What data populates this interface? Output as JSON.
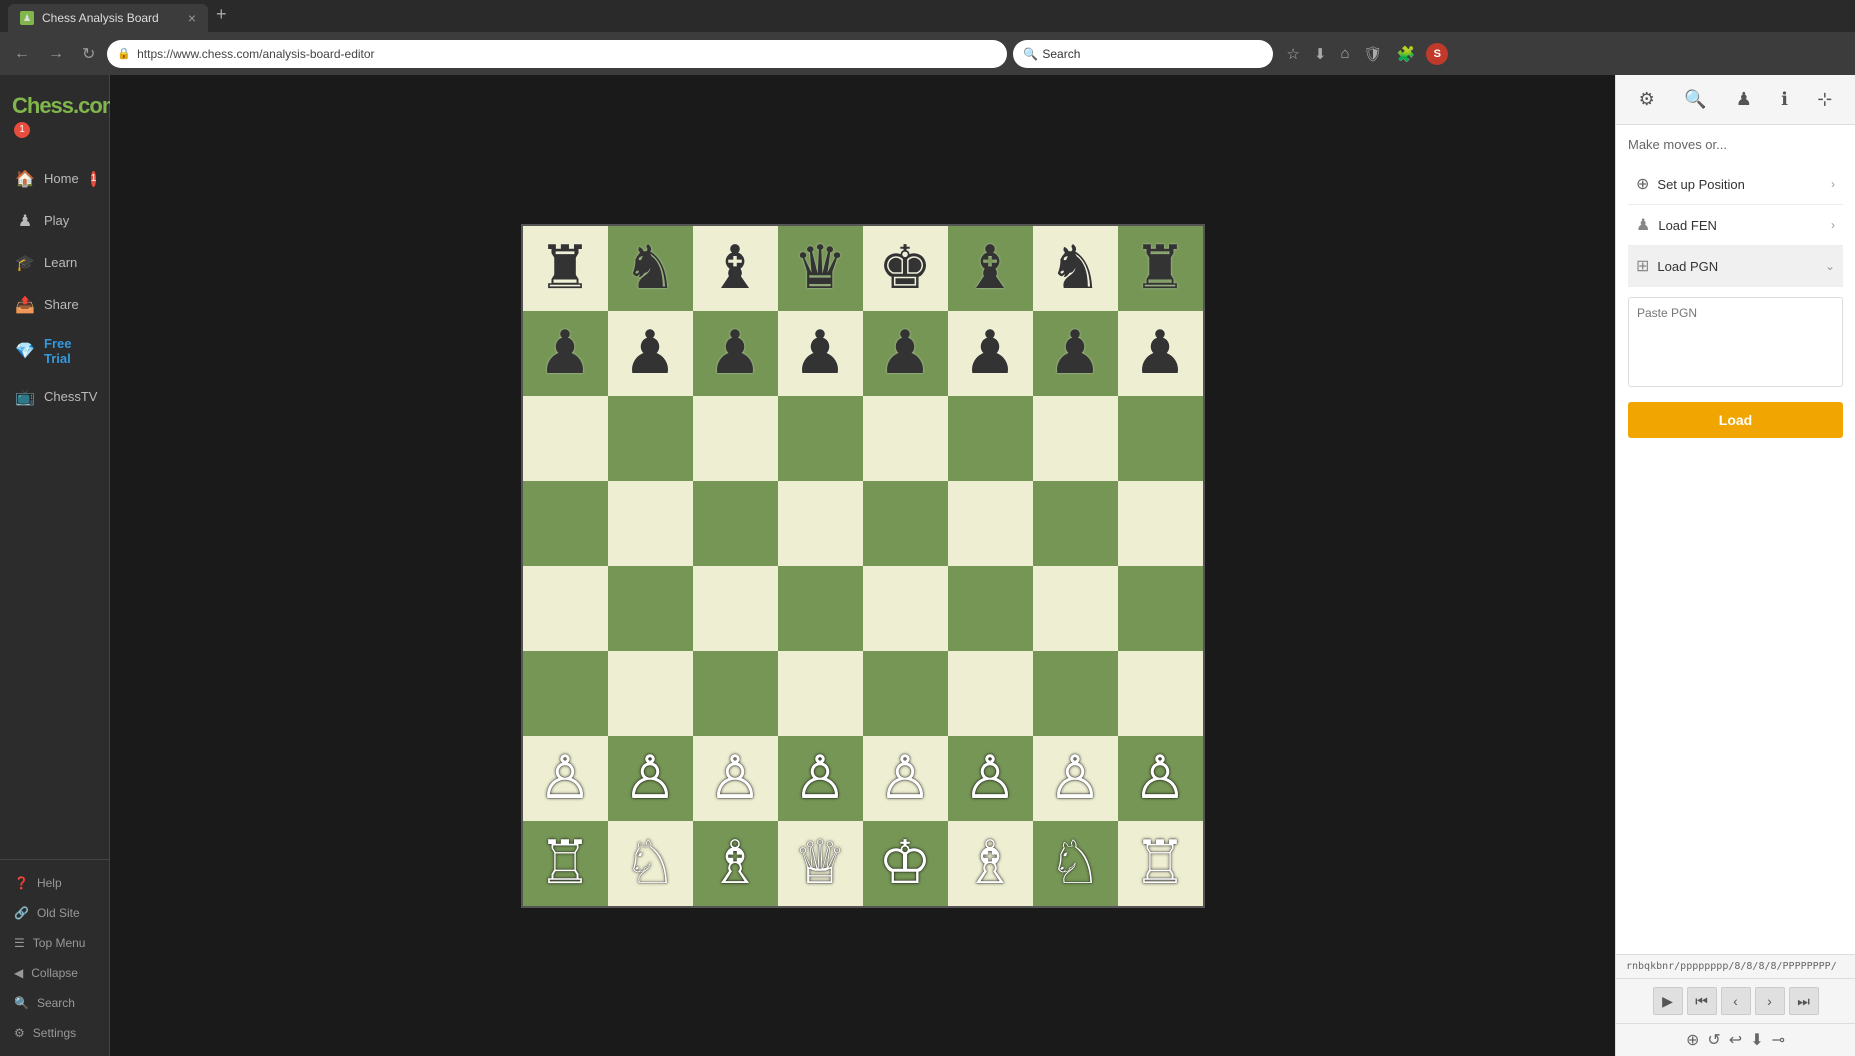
{
  "browser": {
    "tab_title": "Chess Analysis Board",
    "url": "https://www.chess.com/analysis-board-editor",
    "search_placeholder": "Search",
    "new_tab_symbol": "+",
    "tab_close": "×"
  },
  "sidebar": {
    "logo_text": "Chess.com",
    "logo_badge": "1",
    "items": [
      {
        "id": "home",
        "label": "Home",
        "icon": "🏠",
        "badge": "1"
      },
      {
        "id": "play",
        "label": "Play",
        "icon": "♟"
      },
      {
        "id": "learn",
        "label": "Learn",
        "icon": "🎓"
      },
      {
        "id": "share",
        "label": "Share",
        "icon": "📤"
      },
      {
        "id": "free-trial",
        "label": "Free Trial",
        "icon": "💎",
        "special": true
      }
    ],
    "bottom_items": [
      {
        "id": "help",
        "label": "Help",
        "icon": "❓"
      },
      {
        "id": "old-site",
        "label": "Old Site",
        "icon": "🔗"
      },
      {
        "id": "top-menu",
        "label": "Top Menu",
        "icon": "☰"
      },
      {
        "id": "collapse",
        "label": "Collapse",
        "icon": "◀"
      },
      {
        "id": "search",
        "label": "Search",
        "icon": "🔍"
      },
      {
        "id": "settings",
        "label": "Settings",
        "icon": "⚙"
      }
    ]
  },
  "panel": {
    "make_moves_label": "Make moves or...",
    "setup_position": "Set up Position",
    "load_fen": "Load FEN",
    "load_pgn": "Load PGN",
    "pgn_placeholder": "Paste PGN",
    "load_button": "Load",
    "fen_value": "rnbqkbnr/pppppppp/8/8/8/8/PPPPPPPP/",
    "tools": [
      "⚙",
      "🔍",
      "♟",
      "ℹ",
      "⊹"
    ]
  },
  "board": {
    "initial_position": [
      [
        "br",
        "bn",
        "bb",
        "bq",
        "bk",
        "bb",
        "bn",
        "br"
      ],
      [
        "bp",
        "bp",
        "bp",
        "bp",
        "bp",
        "bp",
        "bp",
        "bp"
      ],
      [
        "",
        "",
        "",
        "",
        "",
        "",
        "",
        ""
      ],
      [
        "",
        "",
        "",
        "",
        "",
        "",
        "",
        ""
      ],
      [
        "",
        "",
        "",
        "",
        "",
        "",
        "",
        ""
      ],
      [
        "",
        "",
        "",
        "",
        "",
        "",
        "",
        ""
      ],
      [
        "wp",
        "wp",
        "wp",
        "wp",
        "wp",
        "wp",
        "wp",
        "wp"
      ],
      [
        "wr",
        "wn",
        "wb",
        "wq",
        "wk",
        "wb",
        "wn",
        "wr"
      ]
    ],
    "pieces": {
      "br": "♜",
      "bn": "♞",
      "bb": "♝",
      "bq": "♛",
      "bk": "♚",
      "bp": "♟",
      "wr": "♖",
      "wn": "♘",
      "wb": "♗",
      "wq": "♕",
      "wk": "♔",
      "wp": "♙"
    }
  },
  "chess_tv": {
    "label": "ChessTV",
    "icon": "📺"
  }
}
